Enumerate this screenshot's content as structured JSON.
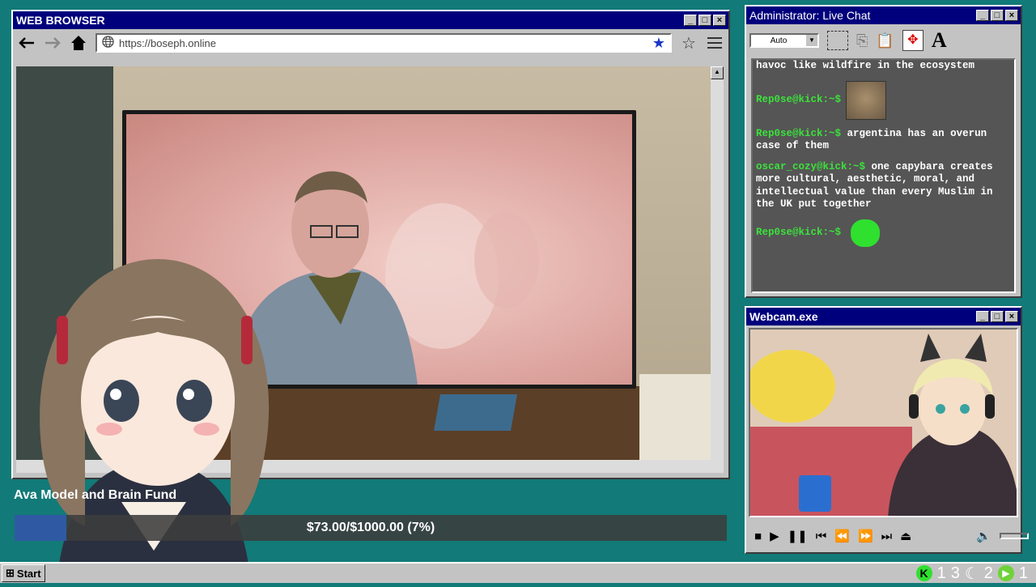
{
  "browser": {
    "title": "WEB BROWSER",
    "url": "https://boseph.online"
  },
  "chat": {
    "title": "Administrator: Live Chat",
    "font_select": "Auto",
    "messages": [
      {
        "nick": "",
        "text": "havoc like wildfire in the ecosystem"
      },
      {
        "nick": "Rep0se@kick:~$",
        "text": "",
        "image": "capybara-image"
      },
      {
        "nick": "Rep0se@kick:~$",
        "text": "argentina has an overun case of them"
      },
      {
        "nick": "oscar_cozy@kick:~$",
        "text": "one capybara creates more cultural, aesthetic, moral, and intellectual value than every Muslim in the UK put together"
      },
      {
        "nick": "Rep0se@kick:~$",
        "text": "",
        "image": "green-emote"
      }
    ]
  },
  "webcam": {
    "title": "Webcam.exe"
  },
  "fund": {
    "title": "Ava Model and Brain Fund",
    "text": "$73.00/$1000.00 (7%)",
    "progress": 0.073
  },
  "taskbar": {
    "start_label": "Start",
    "counts": [
      "1",
      "3",
      "2",
      "1"
    ]
  },
  "colors": {
    "desktop": "#127a78",
    "titlebar": "#00007c",
    "chat_nick": "#3be23b",
    "fund_fill": "#2f5aa3"
  }
}
